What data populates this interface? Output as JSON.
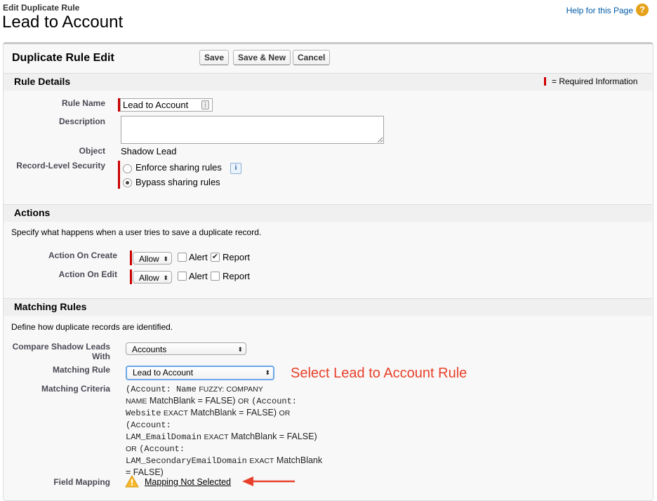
{
  "header": {
    "breadcrumb": "Edit Duplicate Rule",
    "title": "Lead to Account",
    "help_link": "Help for this Page",
    "help_icon": "?"
  },
  "edit_block": {
    "title": "Duplicate Rule Edit",
    "buttons": {
      "save": "Save",
      "save_new": "Save & New",
      "cancel": "Cancel"
    }
  },
  "rule_details": {
    "heading": "Rule Details",
    "required_legend": "= Required Information",
    "rule_name": {
      "label": "Rule Name",
      "value": "Lead to Account"
    },
    "description": {
      "label": "Description",
      "value": ""
    },
    "object": {
      "label": "Object",
      "value": "Shadow Lead"
    },
    "security": {
      "label": "Record-Level Security",
      "options": [
        "Enforce sharing rules",
        "Bypass sharing rules"
      ],
      "selected": "Bypass sharing rules",
      "info_icon": "i"
    }
  },
  "actions": {
    "heading": "Actions",
    "description": "Specify what happens when a user tries to save a duplicate record.",
    "on_create": {
      "label": "Action On Create",
      "value": "Allow",
      "alert_label": "Alert",
      "report_label": "Report",
      "alert_checked": false,
      "report_checked": true
    },
    "on_edit": {
      "label": "Action On Edit",
      "value": "Allow",
      "alert_label": "Alert",
      "report_label": "Report",
      "alert_checked": false,
      "report_checked": false
    }
  },
  "matching_rules": {
    "heading": "Matching Rules",
    "description": "Define how duplicate records are identified.",
    "compare_with": {
      "label_line1": "Compare Shadow Leads",
      "label_line2": "With",
      "value": "Accounts"
    },
    "matching_rule": {
      "label": "Matching Rule",
      "value": "Lead to Account"
    },
    "annotation": "Select Lead to Account Rule",
    "criteria_label": "Matching Criteria",
    "criteria": {
      "l1a": "(Account: Name",
      "l1b": "FUZZY: COMPANY",
      "l2a": "NAME",
      "l2b": "MatchBlank = FALSE)",
      "l2c": "OR",
      "l2d": "(Account:",
      "l3a": "Website",
      "l3b": "EXACT",
      "l3c": "MatchBlank = FALSE)",
      "l3d": "OR",
      "l4a": "(Account:",
      "l5a": "LAM_EmailDomain",
      "l5b": "EXACT",
      "l5c": "MatchBlank = FALSE)",
      "l6a": "OR",
      "l6b": "(Account:",
      "l7a": "LAM_SecondaryEmailDomain",
      "l7b": "EXACT",
      "l7c": "MatchBlank",
      "l8a": "= FALSE)"
    },
    "field_mapping": {
      "label": "Field Mapping",
      "link": "Mapping Not Selected",
      "icon": "warning-icon"
    }
  },
  "colors": {
    "accent_red": "#e8402a",
    "required": "#cc0000",
    "link": "#015ba7"
  }
}
